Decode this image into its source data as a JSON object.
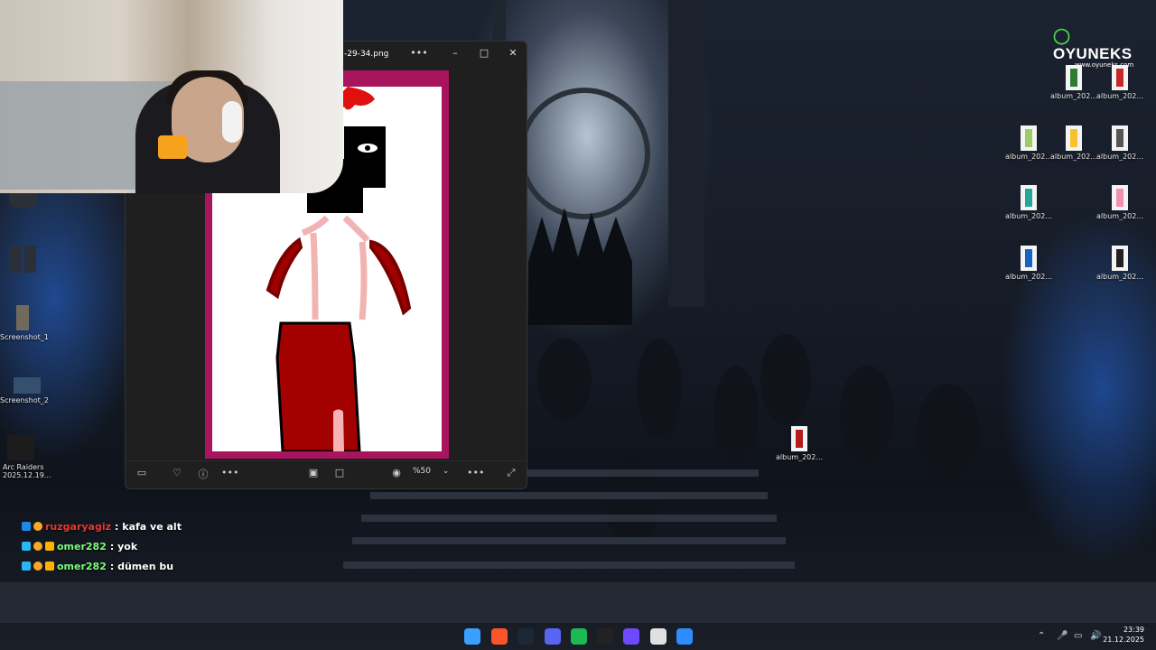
{
  "brand": {
    "name": "OYUNEKS",
    "url": "www.oyuneks.com"
  },
  "photos_window": {
    "filename": "-29-34.png",
    "zoom": "%50",
    "more_label": "•••",
    "minimize": "–",
    "maximize": "□",
    "close": "✕"
  },
  "desktop": {
    "right_icons": [
      {
        "label": "album_202...",
        "color": "#2e7d32"
      },
      {
        "label": "album_202...",
        "color": "#c62828"
      },
      {
        "label": "album_202...",
        "color": "#9ccc65"
      },
      {
        "label": "album_202...",
        "color": "#fbc02d"
      },
      {
        "label": "album_202...",
        "color": "#555555"
      },
      {
        "label": "album_202...",
        "color": "#26a69a"
      },
      {
        "label": "album_202...",
        "color": "#f48fb1"
      },
      {
        "label": "album_202...",
        "color": "#1565c0"
      },
      {
        "label": "album_202...",
        "color": "#212121"
      },
      {
        "label": "album_202...",
        "color": "#b71c1c"
      }
    ],
    "left_icons": [
      {
        "label": "Screenshot_1"
      },
      {
        "label": "Screenshot_2"
      },
      {
        "label": "Arc Raiders",
        "sub": "2025.12.19..."
      }
    ]
  },
  "chat": [
    {
      "user": "ruzgaryagiz",
      "color": "#e53935",
      "message": ": kafa ve alt"
    },
    {
      "user": "omer282",
      "color": "#7cfc7c",
      "message": ": yok"
    },
    {
      "user": "omer282",
      "color": "#7cfc7c",
      "message": ": dümen bu"
    }
  ],
  "taskbar": {
    "icons": [
      "windows-start-icon",
      "brave-icon",
      "steam-icon",
      "discord-icon",
      "spotify-icon",
      "github-icon",
      "proton-icon",
      "settings-icon",
      "photos-icon"
    ],
    "icon_colors": [
      "#3aa0ff",
      "#fb542b",
      "#1b2838",
      "#5865f2",
      "#1db954",
      "#222222",
      "#6d4aff",
      "#e0e0e0",
      "#2f8cff"
    ],
    "time": "23:39",
    "date": "21.12.2025"
  }
}
